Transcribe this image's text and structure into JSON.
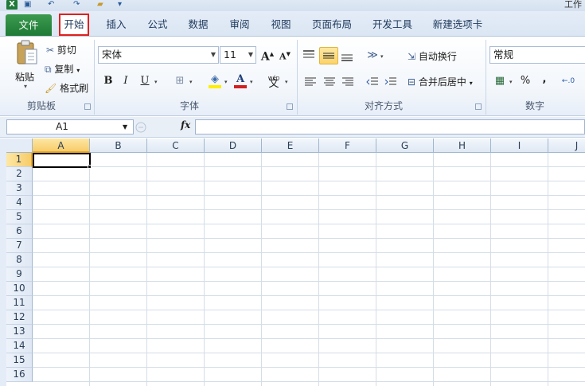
{
  "window": {
    "title_fragment": "工作"
  },
  "tabs": {
    "file": "文件",
    "home": "开始",
    "insert": "插入",
    "formula": "公式",
    "data": "数据",
    "review": "审阅",
    "view": "视图",
    "page_layout": "页面布局",
    "developer": "开发工具",
    "new_tab": "新建选项卡"
  },
  "ribbon": {
    "clipboard": {
      "paste": "粘贴",
      "cut": "剪切",
      "copy": "复制",
      "format_painter": "格式刷",
      "group_label": "剪贴板"
    },
    "font": {
      "font_name": "宋体",
      "font_size": "11",
      "grow": "A",
      "shrink": "A",
      "bold": "B",
      "italic": "I",
      "underline": "U",
      "font_color_glyph": "A",
      "phonetic_top": "wén",
      "phonetic_glyph": "文",
      "group_label": "字体"
    },
    "alignment": {
      "wrap_text": "自动换行",
      "merge_center": "合并后居中",
      "group_label": "对齐方式"
    },
    "number": {
      "format": "常规",
      "percent": "%",
      "comma": ",",
      "group_label": "数字"
    }
  },
  "formula_bar": {
    "name_box": "A1",
    "fx": "fx",
    "value": ""
  },
  "sheet": {
    "columns": [
      "A",
      "B",
      "C",
      "D",
      "E",
      "F",
      "G",
      "H",
      "I",
      "J"
    ],
    "rows": [
      "1",
      "2",
      "3",
      "4",
      "5",
      "6",
      "7",
      "8",
      "9",
      "10",
      "11",
      "12",
      "13",
      "14",
      "15",
      "16"
    ],
    "selected_cell": "A1"
  },
  "colors": {
    "file_tab": "#1e7a35",
    "home_highlight": "#e0201d",
    "selection_header": "#f7cc6a"
  }
}
